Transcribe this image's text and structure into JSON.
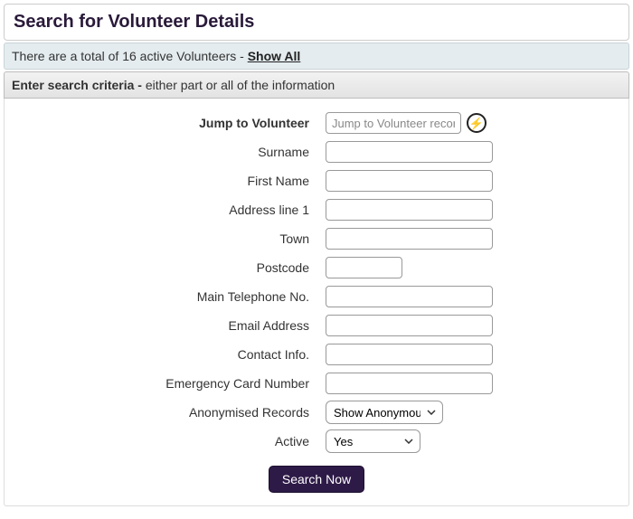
{
  "header": {
    "title": "Search for Volunteer Details"
  },
  "summary": {
    "prefix": "There are a total of ",
    "count": "16",
    "suffix": " active Volunteers - ",
    "show_all": "Show All"
  },
  "criteria_bar": {
    "strong": "Enter search criteria - ",
    "rest": "either part or all of the information"
  },
  "form": {
    "jump": {
      "label": "Jump to Volunteer",
      "placeholder": "Jump to Volunteer record..."
    },
    "surname": {
      "label": "Surname"
    },
    "first_name": {
      "label": "First Name"
    },
    "address1": {
      "label": "Address line 1"
    },
    "town": {
      "label": "Town"
    },
    "postcode": {
      "label": "Postcode"
    },
    "phone": {
      "label": "Main Telephone No."
    },
    "email": {
      "label": "Email Address"
    },
    "contact": {
      "label": "Contact Info."
    },
    "emergency": {
      "label": "Emergency Card Number"
    },
    "anonymised": {
      "label": "Anonymised Records",
      "value": "Show Anonymous"
    },
    "active": {
      "label": "Active",
      "value": "Yes"
    },
    "search_button": "Search Now"
  },
  "icons": {
    "bolt": "⚡"
  }
}
